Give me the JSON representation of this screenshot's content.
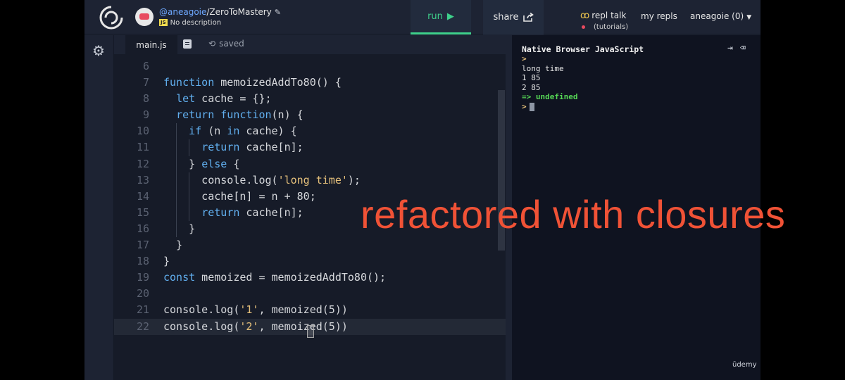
{
  "header": {
    "repl_owner": "@aneagoie",
    "repl_name": "/ZeroToMastery",
    "description": "No description",
    "run_label": "run",
    "share_label": "share",
    "repl_talk_label": "repl talk",
    "tutorials_label": "(tutorials)",
    "my_repls_label": "my repls",
    "user_label": "aneagoie (0)"
  },
  "editor": {
    "tab_label": "main.js",
    "saved_label": "saved",
    "lines": [
      {
        "n": "6",
        "code": ""
      },
      {
        "n": "7",
        "code": "function memoizedAddTo80() {"
      },
      {
        "n": "8",
        "code": "  let cache = {};"
      },
      {
        "n": "9",
        "code": "  return function(n) {"
      },
      {
        "n": "10",
        "code": "    if (n in cache) {"
      },
      {
        "n": "11",
        "code": "      return cache[n];"
      },
      {
        "n": "12",
        "code": "    } else {"
      },
      {
        "n": "13",
        "code": "      console.log('long time');"
      },
      {
        "n": "14",
        "code": "      cache[n] = n + 80;"
      },
      {
        "n": "15",
        "code": "      return cache[n];"
      },
      {
        "n": "16",
        "code": "    }"
      },
      {
        "n": "17",
        "code": "  }"
      },
      {
        "n": "18",
        "code": "}"
      },
      {
        "n": "19",
        "code": "const memoized = memoizedAddTo80();"
      },
      {
        "n": "20",
        "code": ""
      },
      {
        "n": "21",
        "code": "console.log('1', memoized(5))"
      },
      {
        "n": "22",
        "code": "console.log('2', memoized(5))"
      }
    ],
    "active_line": "22"
  },
  "console": {
    "title": "Native Browser JavaScript",
    "lines": [
      {
        "kind": "prompt",
        "text": ">"
      },
      {
        "kind": "out",
        "text": "long time"
      },
      {
        "kind": "out",
        "text": "1 85"
      },
      {
        "kind": "out",
        "text": "2 85"
      },
      {
        "kind": "result",
        "text": "=> undefined"
      },
      {
        "kind": "input",
        "text": ">"
      }
    ]
  },
  "overlay": {
    "caption": "refactored with closures"
  },
  "watermark": "ūdemy",
  "colors": {
    "accent_run": "#3ed08b",
    "caption": "#f05236",
    "keyword": "#61afef",
    "string": "#e5c07b"
  },
  "icons": [
    "repl-logo-icon",
    "gear-icon",
    "play-icon",
    "share-icon",
    "file-icon",
    "history-icon",
    "repl-talk-icon",
    "caret-down-icon",
    "pencil-icon",
    "exit-icon",
    "clear-icon"
  ]
}
